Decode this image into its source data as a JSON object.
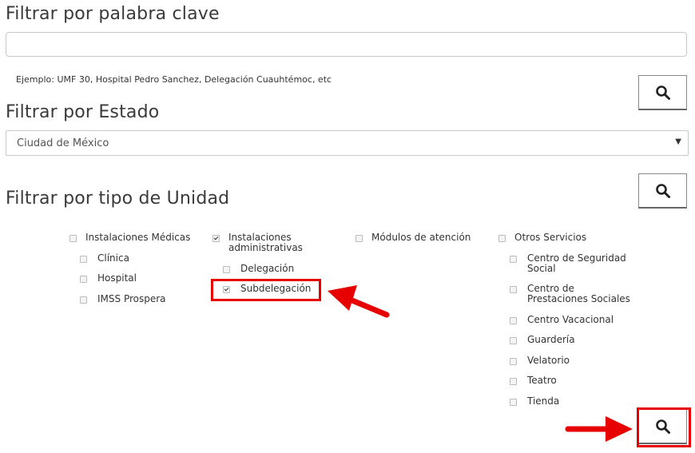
{
  "keyword_filter": {
    "title": "Filtrar por palabra clave",
    "input_value": "",
    "hint": "Ejemplo: UMF 30, Hospital Pedro Sanchez, Delegación Cuauhtémoc, etc"
  },
  "state_filter": {
    "title": "Filtrar por Estado",
    "selected": "Ciudad de México"
  },
  "unit_filter": {
    "title": "Filtrar por tipo de Unidad",
    "groups": [
      {
        "label": "Instalaciones Médicas",
        "checked": false,
        "items": [
          {
            "label": "Clínica",
            "checked": false
          },
          {
            "label": "Hospital",
            "checked": false
          },
          {
            "label": "IMSS Prospera",
            "checked": false
          }
        ]
      },
      {
        "label_line1": "Instalaciones",
        "label_line2": "administrativas",
        "checked": true,
        "items": [
          {
            "label": "Delegación",
            "checked": false
          },
          {
            "label": "Subdelegación",
            "checked": true
          }
        ]
      },
      {
        "label": "Módulos de atención",
        "checked": false,
        "items": []
      },
      {
        "label": "Otros Servicios",
        "checked": false,
        "items": [
          {
            "line1": "Centro de Seguridad",
            "line2": "Social",
            "checked": false
          },
          {
            "line1": "Centro de",
            "line2": "Prestaciones Sociales",
            "checked": false
          },
          {
            "label": "Centro Vacacional",
            "checked": false
          },
          {
            "label": "Guardería",
            "checked": false
          },
          {
            "label": "Velatorio",
            "checked": false
          },
          {
            "label": "Teatro",
            "checked": false
          },
          {
            "label": "Tienda",
            "checked": false
          }
        ]
      }
    ]
  },
  "icons": {
    "search": "search-icon",
    "caret": "chevron-down-icon",
    "arrow": "arrow-annotation"
  },
  "colors": {
    "annotation": "#e60000"
  }
}
